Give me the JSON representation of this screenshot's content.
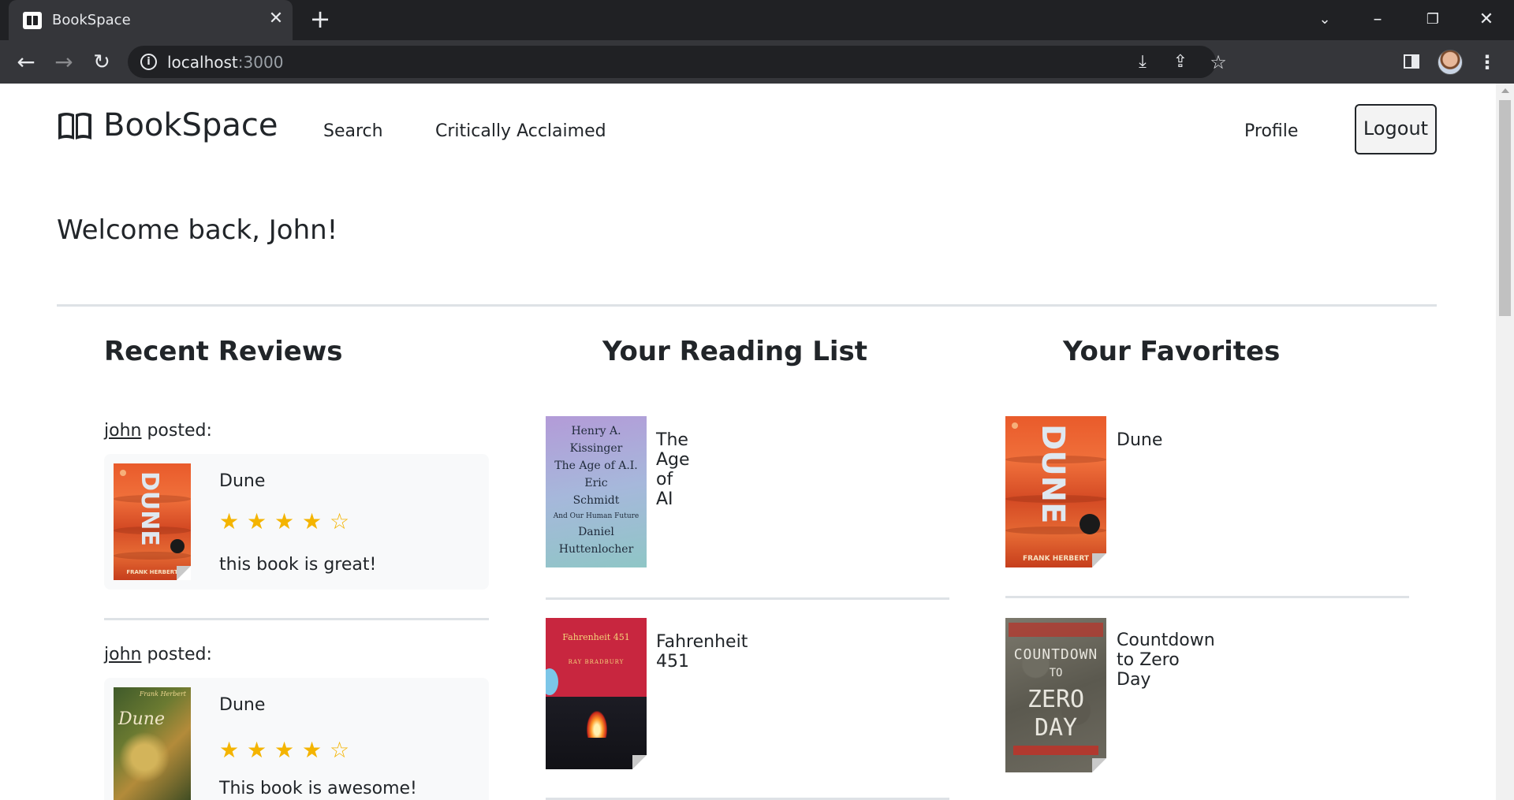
{
  "browser": {
    "tab_title": "BookSpace",
    "url_host": "localhost",
    "url_port": ":3000"
  },
  "navbar": {
    "brand": "BookSpace",
    "links": [
      "Search",
      "Critically Acclaimed"
    ],
    "profile": "Profile",
    "logout": "Logout"
  },
  "welcome": "Welcome back, John!",
  "sections": {
    "reviews_title": "Recent Reviews",
    "reading_title": "Your Reading List",
    "favorites_title": "Your Favorites"
  },
  "reviews": [
    {
      "user": "john",
      "posted": " posted:",
      "book": "Dune",
      "rating": 4,
      "max_rating": 5,
      "text": "this book is great!",
      "cover": "dune-orange"
    },
    {
      "user": "john",
      "posted": " posted:",
      "book": "Dune",
      "rating": 4,
      "max_rating": 5,
      "text": "This book is awesome!",
      "cover": "dune-classic"
    }
  ],
  "reading_list": [
    {
      "title": "The Age of AI",
      "cover_text": [
        "Henry A.",
        "Kissinger",
        "The Age of A.I.",
        "Eric",
        "Schmidt",
        "And Our Human Future",
        "Daniel",
        "Huttenlocher"
      ]
    },
    {
      "title": "Fahrenheit 451",
      "cover_text": [
        "Fahrenheit 451",
        "RAY BRADBURY"
      ]
    }
  ],
  "favorites": [
    {
      "title": "Dune",
      "cover_text": [
        "DUNE",
        "FRANK HERBERT"
      ]
    },
    {
      "title": "Countdown to Zero Day",
      "cover_text": [
        "COUNTDOWN",
        "TO",
        "ZERO",
        "DAY"
      ]
    }
  ],
  "colors": {
    "star": "#f4b400",
    "divider": "#dee2e6",
    "card_bg": "#f8f9fa"
  }
}
